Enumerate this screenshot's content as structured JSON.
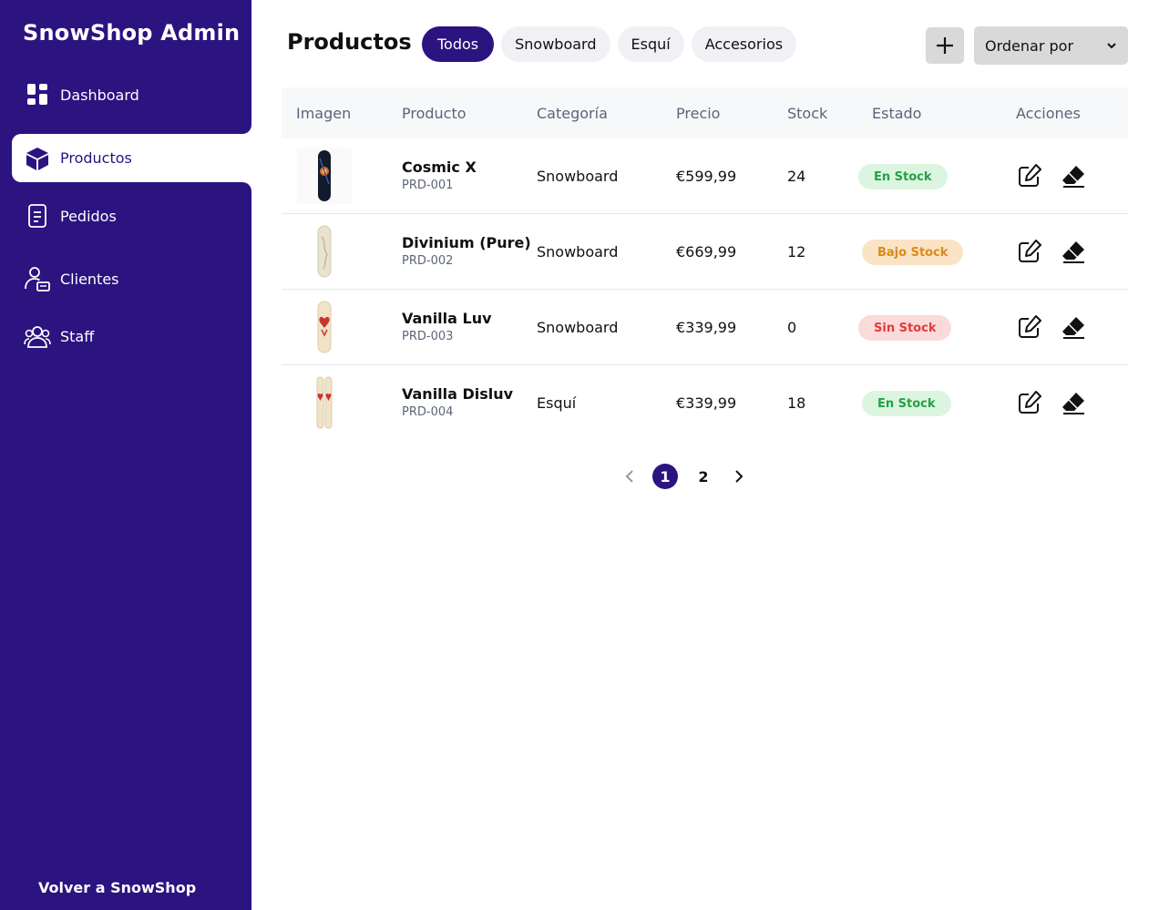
{
  "sidebar": {
    "brand": "SnowShop Admin",
    "items": [
      {
        "label": "Dashboard",
        "icon": "dashboard-grid-icon"
      },
      {
        "label": "Productos",
        "icon": "box-icon",
        "active": true
      },
      {
        "label": "Pedidos",
        "icon": "document-icon"
      },
      {
        "label": "Clientes",
        "icon": "user-card-icon"
      },
      {
        "label": "Staff",
        "icon": "users-icon"
      }
    ],
    "back_link": "Volver a SnowShop",
    "colors": {
      "background": "#2b1380",
      "active_bg": "#ffffff"
    }
  },
  "header": {
    "title": "Productos",
    "filters": [
      "Todos",
      "Snowboard",
      "Esquí",
      "Accesorios"
    ],
    "active_filter": "Todos",
    "add_icon": "plus-icon",
    "sort_label": "Ordenar por"
  },
  "table": {
    "columns": [
      "Imagen",
      "Producto",
      "Categoría",
      "Precio",
      "Stock",
      "Estado",
      "Acciones"
    ],
    "rows": [
      {
        "name": "Cosmic X",
        "code": "PRD-001",
        "category": "Snowboard",
        "price": "€599,99",
        "stock": "24",
        "status": "En Stock",
        "status_kind": "ok"
      },
      {
        "name": "Divinium (Pure)",
        "code": "PRD-002",
        "category": "Snowboard",
        "price": "€669,99",
        "stock": "12",
        "status": "Bajo Stock",
        "status_kind": "low"
      },
      {
        "name": "Vanilla Luv",
        "code": "PRD-003",
        "category": "Snowboard",
        "price": "€339,99",
        "stock": "0",
        "status": "Sin Stock",
        "status_kind": "out"
      },
      {
        "name": "Vanilla Disluv",
        "code": "PRD-004",
        "category": "Esquí",
        "price": "€339,99",
        "stock": "18",
        "status": "En Stock",
        "status_kind": "ok"
      }
    ],
    "action_icons": [
      "edit-icon",
      "eraser-delete-icon"
    ]
  },
  "pagination": {
    "pages": [
      "1",
      "2"
    ],
    "current": "1"
  },
  "colors": {
    "accent": "#2b1380",
    "in_stock": "#23a244",
    "low_stock": "#d98a1c",
    "out_stock": "#e23b3b"
  }
}
